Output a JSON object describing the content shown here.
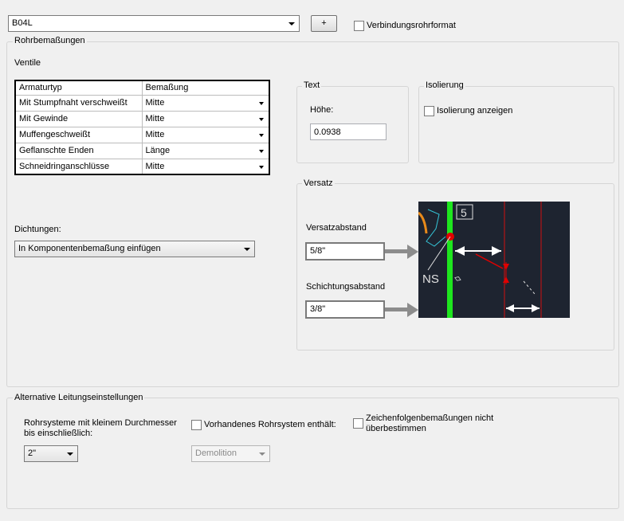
{
  "top": {
    "style_value": "B04L",
    "add_button": "+",
    "connection_format_label": "Verbindungsrohrformat"
  },
  "pipe_dims": {
    "title": "Rohrbemaßungen",
    "valves_label": "Ventile",
    "table": {
      "headers": [
        "Armaturtyp",
        "Bemaßung"
      ],
      "rows": [
        {
          "type": "Mit Stumpfnaht verschweißt",
          "dim": "Mitte"
        },
        {
          "type": "Mit Gewinde",
          "dim": "Mitte"
        },
        {
          "type": "Muffengeschweißt",
          "dim": "Mitte"
        },
        {
          "type": "Geflanschte Enden",
          "dim": "Länge"
        },
        {
          "type": "Schneidringanschlüsse",
          "dim": "Mitte"
        }
      ]
    },
    "gaskets_label": "Dichtungen:",
    "gaskets_value": "In Komponentenbemaßung einfügen",
    "text_group": {
      "title": "Text",
      "height_label": "Höhe:",
      "height_value": "0.0938"
    },
    "insulation_group": {
      "title": "Isolierung",
      "show_label": "Isolierung anzeigen"
    },
    "offset_group": {
      "title": "Versatz",
      "offset_distance_label": "Versatzabstand",
      "offset_distance_value": "5/8\"",
      "stacking_distance_label": "Schichtungsabstand",
      "stacking_distance_value": "3/8\"",
      "preview_texts": {
        "number": "5",
        "ns": "NS"
      }
    }
  },
  "alt_settings": {
    "title": "Alternative Leitungseinstellungen",
    "small_diam_label": "Rohrsysteme mit kleinem Durchmesser bis einschließlich:",
    "small_diam_value": "2\"",
    "existing_system_label": "Vorhandenes Rohrsystem enthält:",
    "existing_system_value": "Demolition",
    "override_label": "Zeichenfolgenbemaßungen  nicht überbestimmen"
  },
  "colors": {
    "preview_bg": "#1e2430",
    "pipe_green": "#1ee61e",
    "accent_red": "#e00000"
  }
}
